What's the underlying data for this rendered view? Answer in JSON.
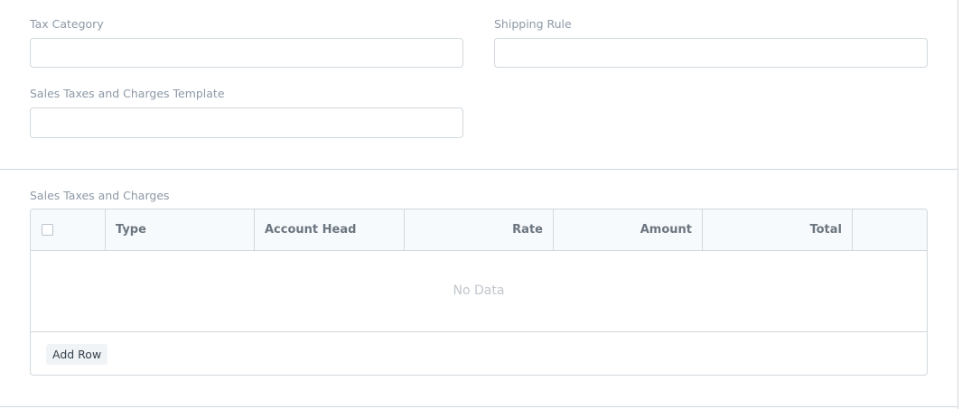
{
  "fields": {
    "tax_category": {
      "label": "Tax Category",
      "value": ""
    },
    "shipping_rule": {
      "label": "Shipping Rule",
      "value": ""
    },
    "taxes_template": {
      "label": "Sales Taxes and Charges Template",
      "value": ""
    }
  },
  "taxes_table": {
    "label": "Sales Taxes and Charges",
    "columns": [
      "Type",
      "Account Head",
      "Rate",
      "Amount",
      "Total"
    ],
    "empty_text": "No Data",
    "add_row_label": "Add Row"
  },
  "colors": {
    "border": "#d1d8dd",
    "label": "#8d99a6",
    "header_bg": "#f7fafc"
  }
}
